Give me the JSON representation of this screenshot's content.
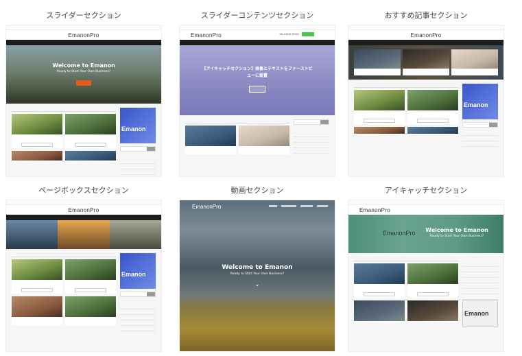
{
  "cells": [
    {
      "title": "スライダーセクション",
      "logo": "EmanonPro",
      "hero_title": "Welcome to Emanon",
      "hero_sub": "Ready to Start Your Own Business?"
    },
    {
      "title": "スライダーコンテンツセクション",
      "logo": "EmanonPro",
      "phone": "00-0000-0000",
      "hero_title": "【アイキャッチセクション】画像とテキストをファーストビューに設置"
    },
    {
      "title": "おすすめ記事セクション",
      "logo": "EmanonPro"
    },
    {
      "title": "ページボックスセクション",
      "logo": "EmanonPro"
    },
    {
      "title": "動画セクション",
      "logo": "EmanonPro",
      "hero_title": "Welcome to Emanon",
      "hero_sub": "Ready to Start Your Own Business?"
    },
    {
      "title": "アイキャッチセクション",
      "logo": "EmanonPro",
      "hero_title": "Welcome to Emanon",
      "hero_sub": "Ready to Start Your Own Business?"
    }
  ],
  "side_ad_text": "Emanon",
  "brand_colors": {
    "hero_button": "#e85a1c",
    "nav": "#1c1c1c",
    "ad": "#3a56c9"
  },
  "icons": [
    "chevron-right-icon",
    "search-icon"
  ]
}
